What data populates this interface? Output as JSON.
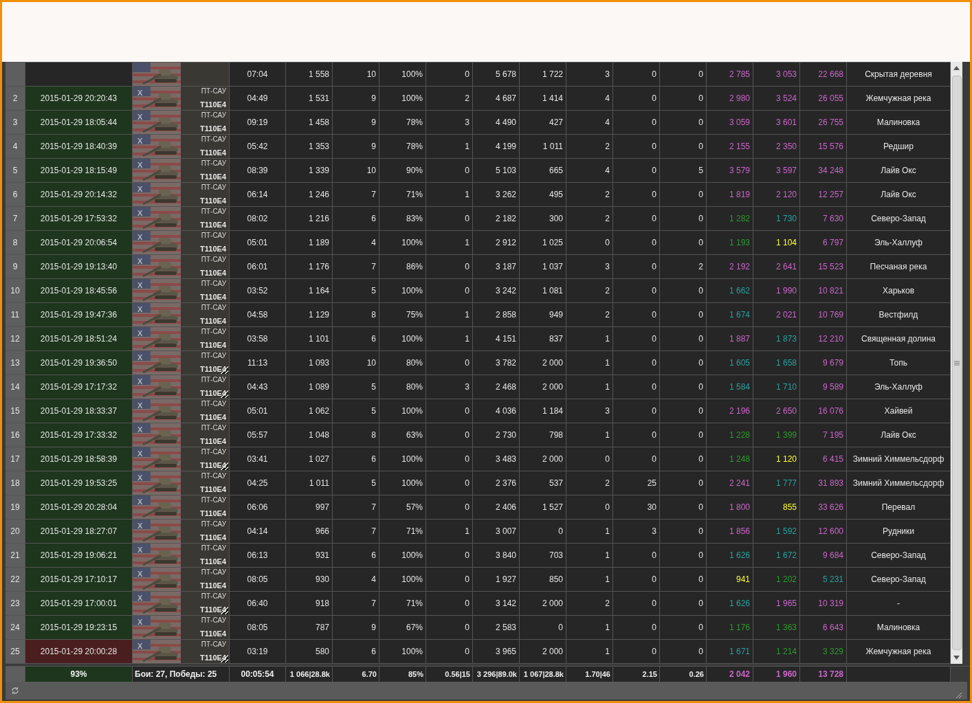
{
  "rows": [
    {
      "time": "07:04",
      "cells": [
        "1 558",
        "10",
        "100%",
        "0",
        "5 678",
        "1 722",
        "3",
        "0",
        "0"
      ],
      "scores": [
        {
          "text": "2 785",
          "color": "#cc66cc"
        },
        {
          "text": "3 053",
          "color": "#cc66cc"
        },
        {
          "text": "22 668",
          "color": "#cc66cc"
        }
      ],
      "map": "Скрытая деревня"
    },
    {
      "n": "2",
      "date": "2015-01-29 20:20:43",
      "defeat": false,
      "tier": "X",
      "type": "ПТ-САУ",
      "tank": "T110E4",
      "marked": false,
      "time": "04:49",
      "cells": [
        "1 531",
        "9",
        "100%",
        "2",
        "4 687",
        "1 414",
        "4",
        "0",
        "0"
      ],
      "scores": [
        {
          "text": "2 980",
          "color": "#cc66cc"
        },
        {
          "text": "3 524",
          "color": "#cc66cc"
        },
        {
          "text": "26 055",
          "color": "#cc66cc"
        }
      ],
      "map": "Жемчужная река"
    },
    {
      "n": "3",
      "date": "2015-01-29 18:05:44",
      "defeat": false,
      "tier": "X",
      "type": "ПТ-САУ",
      "tank": "T110E4",
      "marked": false,
      "time": "09:19",
      "cells": [
        "1 458",
        "9",
        "78%",
        "3",
        "4 490",
        "427",
        "4",
        "0",
        "0"
      ],
      "scores": [
        {
          "text": "3 059",
          "color": "#cc66cc"
        },
        {
          "text": "3 601",
          "color": "#cc66cc"
        },
        {
          "text": "26 755",
          "color": "#cc66cc"
        }
      ],
      "map": "Малиновка"
    },
    {
      "n": "4",
      "date": "2015-01-29 18:40:39",
      "defeat": false,
      "tier": "X",
      "type": "ПТ-САУ",
      "tank": "T110E4",
      "marked": false,
      "time": "05:42",
      "cells": [
        "1 353",
        "9",
        "78%",
        "1",
        "4 199",
        "1 011",
        "2",
        "0",
        "0"
      ],
      "scores": [
        {
          "text": "2 155",
          "color": "#cc66cc"
        },
        {
          "text": "2 350",
          "color": "#cc66cc"
        },
        {
          "text": "15 576",
          "color": "#cc66cc"
        }
      ],
      "map": "Редшир"
    },
    {
      "n": "5",
      "date": "2015-01-29 18:15:49",
      "defeat": false,
      "tier": "X",
      "type": "ПТ-САУ",
      "tank": "T110E4",
      "marked": false,
      "time": "08:39",
      "cells": [
        "1 339",
        "10",
        "90%",
        "0",
        "5 103",
        "665",
        "4",
        "0",
        "5"
      ],
      "scores": [
        {
          "text": "3 579",
          "color": "#cc66cc"
        },
        {
          "text": "3 597",
          "color": "#cc66cc"
        },
        {
          "text": "34 248",
          "color": "#cc66cc"
        }
      ],
      "map": "Лайв Окс"
    },
    {
      "n": "6",
      "date": "2015-01-29 20:14:32",
      "defeat": false,
      "tier": "X",
      "type": "ПТ-САУ",
      "tank": "T110E4",
      "marked": false,
      "time": "06:14",
      "cells": [
        "1 246",
        "7",
        "71%",
        "1",
        "3 262",
        "495",
        "2",
        "0",
        "0"
      ],
      "scores": [
        {
          "text": "1 819",
          "color": "#cc66cc"
        },
        {
          "text": "2 120",
          "color": "#cc66cc"
        },
        {
          "text": "12 257",
          "color": "#cc66cc"
        }
      ],
      "map": "Лайв Окс"
    },
    {
      "n": "7",
      "date": "2015-01-29 17:53:32",
      "defeat": false,
      "tier": "X",
      "type": "ПТ-САУ",
      "tank": "T110E4",
      "marked": false,
      "time": "08:02",
      "cells": [
        "1 216",
        "6",
        "83%",
        "0",
        "2 182",
        "300",
        "2",
        "0",
        "0"
      ],
      "scores": [
        {
          "text": "1 282",
          "color": "#2e9a2e"
        },
        {
          "text": "1 730",
          "color": "#2aa0a0"
        },
        {
          "text": "7 630",
          "color": "#cc66cc"
        }
      ],
      "map": "Северо-Запад"
    },
    {
      "n": "8",
      "date": "2015-01-29 20:06:54",
      "defeat": false,
      "tier": "X",
      "type": "ПТ-САУ",
      "tank": "T110E4",
      "marked": false,
      "time": "05:01",
      "cells": [
        "1 189",
        "4",
        "100%",
        "1",
        "2 912",
        "1 025",
        "0",
        "0",
        "0"
      ],
      "scores": [
        {
          "text": "1 193",
          "color": "#2e9a2e"
        },
        {
          "text": "1 104",
          "color": "#ffff33"
        },
        {
          "text": "6 797",
          "color": "#cc66cc"
        }
      ],
      "map": "Эль-Халлуф"
    },
    {
      "n": "9",
      "date": "2015-01-29 19:13:40",
      "defeat": false,
      "tier": "X",
      "type": "ПТ-САУ",
      "tank": "T110E4",
      "marked": false,
      "time": "06:01",
      "cells": [
        "1 176",
        "7",
        "86%",
        "0",
        "3 187",
        "1 037",
        "3",
        "0",
        "2"
      ],
      "scores": [
        {
          "text": "2 192",
          "color": "#cc66cc"
        },
        {
          "text": "2 641",
          "color": "#cc66cc"
        },
        {
          "text": "15 523",
          "color": "#cc66cc"
        }
      ],
      "map": "Песчаная река"
    },
    {
      "n": "10",
      "date": "2015-01-29 18:45:56",
      "defeat": false,
      "tier": "X",
      "type": "ПТ-САУ",
      "tank": "T110E4",
      "marked": false,
      "time": "03:52",
      "cells": [
        "1 164",
        "5",
        "100%",
        "0",
        "3 242",
        "1 081",
        "2",
        "0",
        "0"
      ],
      "scores": [
        {
          "text": "1 662",
          "color": "#2aa0a0"
        },
        {
          "text": "1 990",
          "color": "#cc66cc"
        },
        {
          "text": "10 821",
          "color": "#cc66cc"
        }
      ],
      "map": "Харьков"
    },
    {
      "n": "11",
      "date": "2015-01-29 19:47:36",
      "defeat": false,
      "tier": "X",
      "type": "ПТ-САУ",
      "tank": "T110E4",
      "marked": false,
      "time": "04:58",
      "cells": [
        "1 129",
        "8",
        "75%",
        "1",
        "2 858",
        "949",
        "2",
        "0",
        "0"
      ],
      "scores": [
        {
          "text": "1 674",
          "color": "#2aa0a0"
        },
        {
          "text": "2 021",
          "color": "#cc66cc"
        },
        {
          "text": "10 769",
          "color": "#cc66cc"
        }
      ],
      "map": "Вестфилд"
    },
    {
      "n": "12",
      "date": "2015-01-29 18:51:24",
      "defeat": false,
      "tier": "X",
      "type": "ПТ-САУ",
      "tank": "T110E4",
      "marked": false,
      "time": "03:58",
      "cells": [
        "1 101",
        "6",
        "100%",
        "1",
        "4 151",
        "837",
        "1",
        "0",
        "0"
      ],
      "scores": [
        {
          "text": "1 887",
          "color": "#cc66cc"
        },
        {
          "text": "1 873",
          "color": "#2aa0a0"
        },
        {
          "text": "12 210",
          "color": "#cc66cc"
        }
      ],
      "map": "Священная долина"
    },
    {
      "n": "13",
      "date": "2015-01-29 19:36:50",
      "defeat": false,
      "tier": "X",
      "type": "ПТ-САУ",
      "tank": "T110E4",
      "marked": true,
      "time": "11:13",
      "cells": [
        "1 093",
        "10",
        "80%",
        "0",
        "3 782",
        "2 000",
        "1",
        "0",
        "0"
      ],
      "scores": [
        {
          "text": "1 605",
          "color": "#2aa0a0"
        },
        {
          "text": "1 658",
          "color": "#2aa0a0"
        },
        {
          "text": "9 679",
          "color": "#cc66cc"
        }
      ],
      "map": "Топь"
    },
    {
      "n": "14",
      "date": "2015-01-29 17:17:32",
      "defeat": false,
      "tier": "X",
      "type": "ПТ-САУ",
      "tank": "T110E4",
      "marked": true,
      "time": "04:43",
      "cells": [
        "1 089",
        "5",
        "80%",
        "3",
        "2 468",
        "2 000",
        "1",
        "0",
        "0"
      ],
      "scores": [
        {
          "text": "1 584",
          "color": "#2aa0a0"
        },
        {
          "text": "1 710",
          "color": "#2aa0a0"
        },
        {
          "text": "9 589",
          "color": "#cc66cc"
        }
      ],
      "map": "Эль-Халлуф"
    },
    {
      "n": "15",
      "date": "2015-01-29 18:33:37",
      "defeat": false,
      "tier": "X",
      "type": "ПТ-САУ",
      "tank": "T110E4",
      "marked": false,
      "time": "05:01",
      "cells": [
        "1 062",
        "5",
        "100%",
        "0",
        "4 036",
        "1 184",
        "3",
        "0",
        "0"
      ],
      "scores": [
        {
          "text": "2 196",
          "color": "#cc66cc"
        },
        {
          "text": "2 650",
          "color": "#cc66cc"
        },
        {
          "text": "16 076",
          "color": "#cc66cc"
        }
      ],
      "map": "Хайвей"
    },
    {
      "n": "16",
      "date": "2015-01-29 17:33:32",
      "defeat": false,
      "tier": "X",
      "type": "ПТ-САУ",
      "tank": "T110E4",
      "marked": false,
      "time": "05:57",
      "cells": [
        "1 048",
        "8",
        "63%",
        "0",
        "2 730",
        "798",
        "1",
        "0",
        "0"
      ],
      "scores": [
        {
          "text": "1 228",
          "color": "#2e9a2e"
        },
        {
          "text": "1 399",
          "color": "#2e9a2e"
        },
        {
          "text": "7 195",
          "color": "#cc66cc"
        }
      ],
      "map": "Лайв Окс"
    },
    {
      "n": "17",
      "date": "2015-01-29 18:58:39",
      "defeat": false,
      "tier": "X",
      "type": "ПТ-САУ",
      "tank": "T110E4",
      "marked": true,
      "time": "03:41",
      "cells": [
        "1 027",
        "6",
        "100%",
        "0",
        "3 483",
        "2 000",
        "0",
        "0",
        "0"
      ],
      "scores": [
        {
          "text": "1 248",
          "color": "#2e9a2e"
        },
        {
          "text": "1 120",
          "color": "#ffff33"
        },
        {
          "text": "6 415",
          "color": "#cc66cc"
        }
      ],
      "map": "Зимний Химмельсдорф"
    },
    {
      "n": "18",
      "date": "2015-01-29 19:53:25",
      "defeat": false,
      "tier": "X",
      "type": "ПТ-САУ",
      "tank": "T110E4",
      "marked": false,
      "time": "04:25",
      "cells": [
        "1 011",
        "5",
        "100%",
        "0",
        "2 376",
        "537",
        "2",
        "25",
        "0"
      ],
      "scores": [
        {
          "text": "2 241",
          "color": "#cc66cc"
        },
        {
          "text": "1 777",
          "color": "#2aa0a0"
        },
        {
          "text": "31 893",
          "color": "#cc66cc"
        }
      ],
      "map": "Зимний Химмельсдорф"
    },
    {
      "n": "19",
      "date": "2015-01-29 20:28:04",
      "defeat": false,
      "tier": "X",
      "type": "ПТ-САУ",
      "tank": "T110E4",
      "marked": false,
      "time": "06:06",
      "cells": [
        "997",
        "7",
        "57%",
        "0",
        "2 406",
        "1 527",
        "0",
        "30",
        "0"
      ],
      "scores": [
        {
          "text": "1 800",
          "color": "#cc66cc"
        },
        {
          "text": "855",
          "color": "#ffff33"
        },
        {
          "text": "33 626",
          "color": "#cc66cc"
        }
      ],
      "map": "Перевал"
    },
    {
      "n": "20",
      "date": "2015-01-29 18:27:07",
      "defeat": false,
      "tier": "X",
      "type": "ПТ-САУ",
      "tank": "T110E4",
      "marked": false,
      "time": "04:14",
      "cells": [
        "966",
        "7",
        "71%",
        "1",
        "3 007",
        "0",
        "1",
        "3",
        "0"
      ],
      "scores": [
        {
          "text": "1 856",
          "color": "#cc66cc"
        },
        {
          "text": "1 592",
          "color": "#2aa0a0"
        },
        {
          "text": "12 600",
          "color": "#cc66cc"
        }
      ],
      "map": "Рудники"
    },
    {
      "n": "21",
      "date": "2015-01-29 19:06:21",
      "defeat": false,
      "tier": "X",
      "type": "ПТ-САУ",
      "tank": "T110E4",
      "marked": false,
      "time": "06:13",
      "cells": [
        "931",
        "6",
        "100%",
        "0",
        "3 840",
        "703",
        "1",
        "0",
        "0"
      ],
      "scores": [
        {
          "text": "1 626",
          "color": "#2aa0a0"
        },
        {
          "text": "1 672",
          "color": "#2aa0a0"
        },
        {
          "text": "9 684",
          "color": "#cc66cc"
        }
      ],
      "map": "Северо-Запад"
    },
    {
      "n": "22",
      "date": "2015-01-29 17:10:17",
      "defeat": false,
      "tier": "X",
      "type": "ПТ-САУ",
      "tank": "T110E4",
      "marked": false,
      "time": "08:05",
      "cells": [
        "930",
        "4",
        "100%",
        "0",
        "1 927",
        "850",
        "1",
        "0",
        "0"
      ],
      "scores": [
        {
          "text": "941",
          "color": "#ffff33"
        },
        {
          "text": "1 202",
          "color": "#2e9a2e"
        },
        {
          "text": "5 231",
          "color": "#2aa0a0"
        }
      ],
      "map": "Северо-Запад"
    },
    {
      "n": "23",
      "date": "2015-01-29 17:00:01",
      "defeat": false,
      "tier": "X",
      "type": "ПТ-САУ",
      "tank": "T110E4",
      "marked": true,
      "time": "06:40",
      "cells": [
        "918",
        "7",
        "71%",
        "0",
        "3 142",
        "2 000",
        "2",
        "0",
        "0"
      ],
      "scores": [
        {
          "text": "1 626",
          "color": "#2aa0a0"
        },
        {
          "text": "1 965",
          "color": "#cc66cc"
        },
        {
          "text": "10 319",
          "color": "#cc66cc"
        }
      ],
      "map": "-"
    },
    {
      "n": "24",
      "date": "2015-01-29 19:23:15",
      "defeat": false,
      "tier": "X",
      "type": "ПТ-САУ",
      "tank": "T110E4",
      "marked": false,
      "time": "08:05",
      "cells": [
        "787",
        "9",
        "67%",
        "0",
        "2 583",
        "0",
        "1",
        "0",
        "0"
      ],
      "scores": [
        {
          "text": "1 176",
          "color": "#2e9a2e"
        },
        {
          "text": "1 363",
          "color": "#2e9a2e"
        },
        {
          "text": "6 643",
          "color": "#cc66cc"
        }
      ],
      "map": "Малиновка"
    },
    {
      "n": "25",
      "date": "2015-01-29 20:00:28",
      "defeat": true,
      "tier": "X",
      "type": "ПТ-САУ",
      "tank": "T110E4",
      "marked": true,
      "time": "03:19",
      "cells": [
        "580",
        "6",
        "100%",
        "0",
        "3 965",
        "2 000",
        "1",
        "0",
        "0"
      ],
      "scores": [
        {
          "text": "1 671",
          "color": "#2aa0a0"
        },
        {
          "text": "1 214",
          "color": "#2e9a2e"
        },
        {
          "text": "3 329",
          "color": "#2e9a2e"
        }
      ],
      "map": "Жемчужная река"
    }
  ],
  "summary": {
    "win_rate": "93%",
    "battles": "Бои: 27, Победы: 25",
    "time": "00:05:54",
    "cells": [
      "1 066|28.8k",
      "6.70",
      "85%",
      "0.56|15",
      "3 296|89.0k",
      "1 067|28.8k",
      "1.70|46",
      "2.15",
      "0.26"
    ],
    "scores": [
      {
        "text": "2 042",
        "color": "#cc66cc"
      },
      {
        "text": "1 960",
        "color": "#cc66cc"
      },
      {
        "text": "13 728",
        "color": "#cc66cc"
      }
    ]
  }
}
